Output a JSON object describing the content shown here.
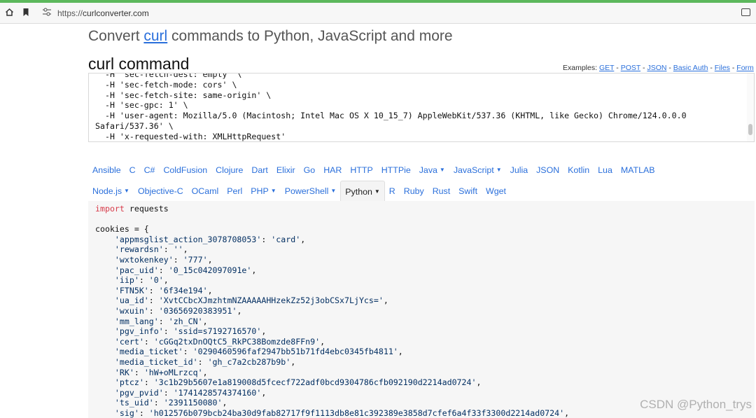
{
  "browser": {
    "url_scheme": "https://",
    "url_host": "curlconverter.com",
    "home_icon": "home-icon",
    "bookmark_icon": "bookmark-icon",
    "site_icon": "site-settings-icon"
  },
  "header": {
    "title_pre": "Convert ",
    "title_link": "curl",
    "title_post": " commands to Python, JavaScript and more"
  },
  "curl": {
    "section_title": "curl command",
    "examples_label": "Examples: ",
    "examples": [
      "GET",
      "POST",
      "JSON",
      "Basic Auth",
      "Files",
      "Form"
    ],
    "lines": [
      "  -H 'sec-fetch-dest: empty' \\",
      "  -H 'sec-fetch-mode: cors' \\",
      "  -H 'sec-fetch-site: same-origin' \\",
      "  -H 'sec-gpc: 1' \\",
      "  -H 'user-agent: Mozilla/5.0 (Macintosh; Intel Mac OS X 10_15_7) AppleWebKit/537.36 (KHTML, like Gecko) Chrome/124.0.0.0",
      "Safari/537.36' \\",
      "  -H 'x-requested-with: XMLHttpRequest'"
    ]
  },
  "languages": {
    "row1": [
      {
        "label": "Ansible"
      },
      {
        "label": "C"
      },
      {
        "label": "C#"
      },
      {
        "label": "ColdFusion"
      },
      {
        "label": "Clojure"
      },
      {
        "label": "Dart"
      },
      {
        "label": "Elixir"
      },
      {
        "label": "Go"
      },
      {
        "label": "HAR"
      },
      {
        "label": "HTTP"
      },
      {
        "label": "HTTPie"
      },
      {
        "label": "Java",
        "dropdown": true
      },
      {
        "label": "JavaScript",
        "dropdown": true
      },
      {
        "label": "Julia"
      },
      {
        "label": "JSON"
      },
      {
        "label": "Kotlin"
      },
      {
        "label": "Lua"
      },
      {
        "label": "MATLAB"
      }
    ],
    "row2": [
      {
        "label": "Node.js",
        "dropdown": true
      },
      {
        "label": "Objective-C"
      },
      {
        "label": "OCaml"
      },
      {
        "label": "Perl"
      },
      {
        "label": "PHP",
        "dropdown": true
      },
      {
        "label": "PowerShell",
        "dropdown": true
      },
      {
        "label": "Python",
        "dropdown": true,
        "active": true
      },
      {
        "label": "R"
      },
      {
        "label": "Ruby"
      },
      {
        "label": "Rust"
      },
      {
        "label": "Swift"
      },
      {
        "label": "Wget"
      }
    ],
    "selected": "Python"
  },
  "output": {
    "import_kw": "import",
    "import_mod": " requests",
    "dict_open": "cookies = {",
    "entries": [
      {
        "key": "'appmsglist_action_3078708053'",
        "value": "'card'"
      },
      {
        "key": "'rewardsn'",
        "value": "''"
      },
      {
        "key": "'wxtokenkey'",
        "value": "'777'"
      },
      {
        "key": "'pac_uid'",
        "value": "'0_15c042097091e'"
      },
      {
        "key": "'iip'",
        "value": "'0'"
      },
      {
        "key": "'FTN5K'",
        "value": "'6f34e194'"
      },
      {
        "key": "'ua_id'",
        "value": "'XvtCCbcXJmzhtmNZAAAAAHHzekZz52j3obCSx7LjYcs='"
      },
      {
        "key": "'wxuin'",
        "value": "'03656920383951'"
      },
      {
        "key": "'mm_lang'",
        "value": "'zh_CN'"
      },
      {
        "key": "'pgv_info'",
        "value": "'ssid=s7192716570'"
      },
      {
        "key": "'cert'",
        "value": "'cGGq2txDnOQtC5_RkPC38Bomzde8FFn9'"
      },
      {
        "key": "'media_ticket'",
        "value": "'0290460596faf2947bb51b71fd4ebc0345fb4811'"
      },
      {
        "key": "'media_ticket_id'",
        "value": "'gh_c7a2cb287b9b'"
      },
      {
        "key": "'RK'",
        "value": "'hW+oMLrzcq'"
      },
      {
        "key": "'ptcz'",
        "value": "'3c1b29b5607e1a819008d5fcecf722adf0bcd9304786cfb092190d2214ad0724'"
      },
      {
        "key": "'pgv_pvid'",
        "value": "'1741428574374160'"
      },
      {
        "key": "'ts_uid'",
        "value": "'2391150080'"
      },
      {
        "key": "'sig'",
        "value": "'h012576b079bcb24ba30d9fab82717f9f1113db8e81c392389e3858d7cfef6a4f33f3300d2214ad0724'"
      }
    ]
  },
  "watermark": "CSDN @Python_trys",
  "colors": {
    "link": "#2a6fdb",
    "keyword": "#d73a49",
    "string": "#032f62",
    "topline": "#5cb85c"
  }
}
